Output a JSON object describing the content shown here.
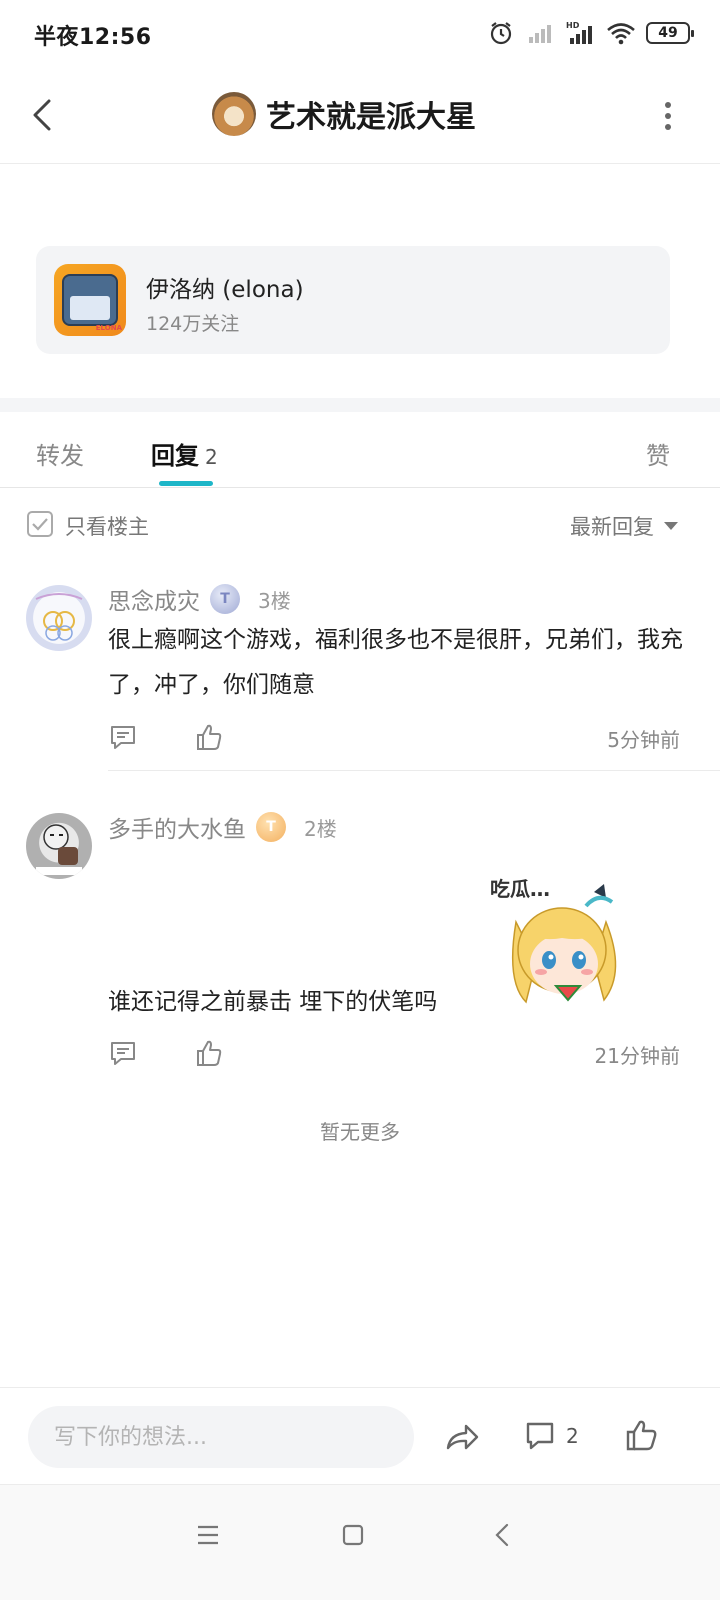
{
  "status_bar": {
    "time": "半夜12:56",
    "battery": "49"
  },
  "header": {
    "title": "艺术就是派大星"
  },
  "game_card": {
    "name": "伊洛纳 (elona)",
    "followers": "124万关注",
    "icon_label": "ELONA"
  },
  "tabs": {
    "repost": "转发",
    "reply": "回复",
    "reply_count": "2",
    "like": "赞"
  },
  "filter": {
    "only_op": "只看楼主",
    "sort": "最新回复"
  },
  "comments": [
    {
      "user": "思念成灾",
      "badge": "T",
      "badge_level": "1",
      "floor": "3楼",
      "text": "很上瘾啊这个游戏，福利很多也不是很肝，兄弟们，我充了，冲了，你们随意",
      "time": "5分钟前"
    },
    {
      "user": "多手的大水鱼",
      "badge": "T",
      "badge_level": "5",
      "floor": "2楼",
      "text": "谁还记得之前暴击 埋下的伏笔吗",
      "time": "21分钟前",
      "sticker_text": "吃瓜…"
    }
  ],
  "no_more": "暂无更多",
  "bottom_bar": {
    "placeholder": "写下你的想法...",
    "comment_count": "2"
  },
  "colors": {
    "accent": "#1eb6c8",
    "text_primary": "#222222",
    "text_secondary": "#888888"
  }
}
